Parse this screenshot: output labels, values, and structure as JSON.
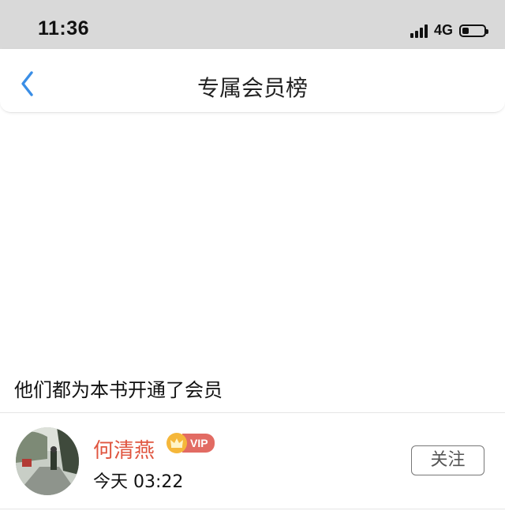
{
  "status_bar": {
    "time": "11:36",
    "network": "4G",
    "battery_level": 0.3,
    "signal_bars": 4
  },
  "nav": {
    "title": "专属会员榜",
    "back_icon": "chevron-left-icon"
  },
  "section": {
    "caption": "他们都为本书开通了会员"
  },
  "members": [
    {
      "name": "何清燕",
      "badge": "VIP",
      "time": "今天 03:22",
      "follow_label": "关注"
    }
  ],
  "colors": {
    "accent_blue": "#3a8ee6",
    "name_red": "#e0553f",
    "vip_red": "#e26b63",
    "crown_gold": "#f5b73a",
    "status_bar_bg": "#d9d9d9"
  }
}
